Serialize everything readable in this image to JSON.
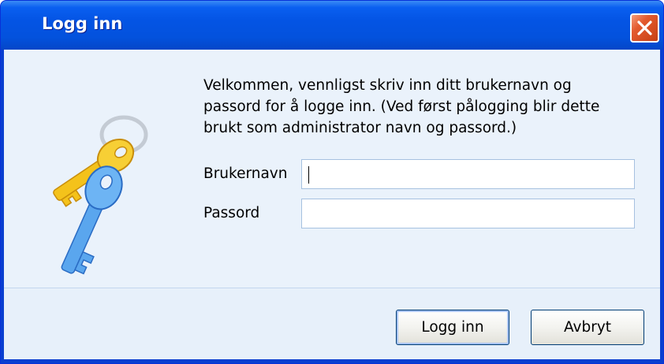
{
  "window": {
    "title": "Logg inn",
    "close_icon": "close-icon"
  },
  "dialog": {
    "icon": "keys-icon",
    "welcome_lines": [
      "Velkommen, vennligst skriv inn ditt brukernavn og",
      "passord for å logge inn.  (Ved først pålogging blir dette",
      "brukt som administrator navn og passord.)"
    ],
    "username_label": "Brukernavn",
    "username_value": "",
    "password_label": "Passord",
    "password_value": ""
  },
  "buttons": {
    "login_label": "Logg inn",
    "cancel_label": "Avbryt"
  },
  "colors": {
    "titlebar": "#0454e4",
    "client_background": "#eaf2fb",
    "close_button": "#e35a2e"
  }
}
